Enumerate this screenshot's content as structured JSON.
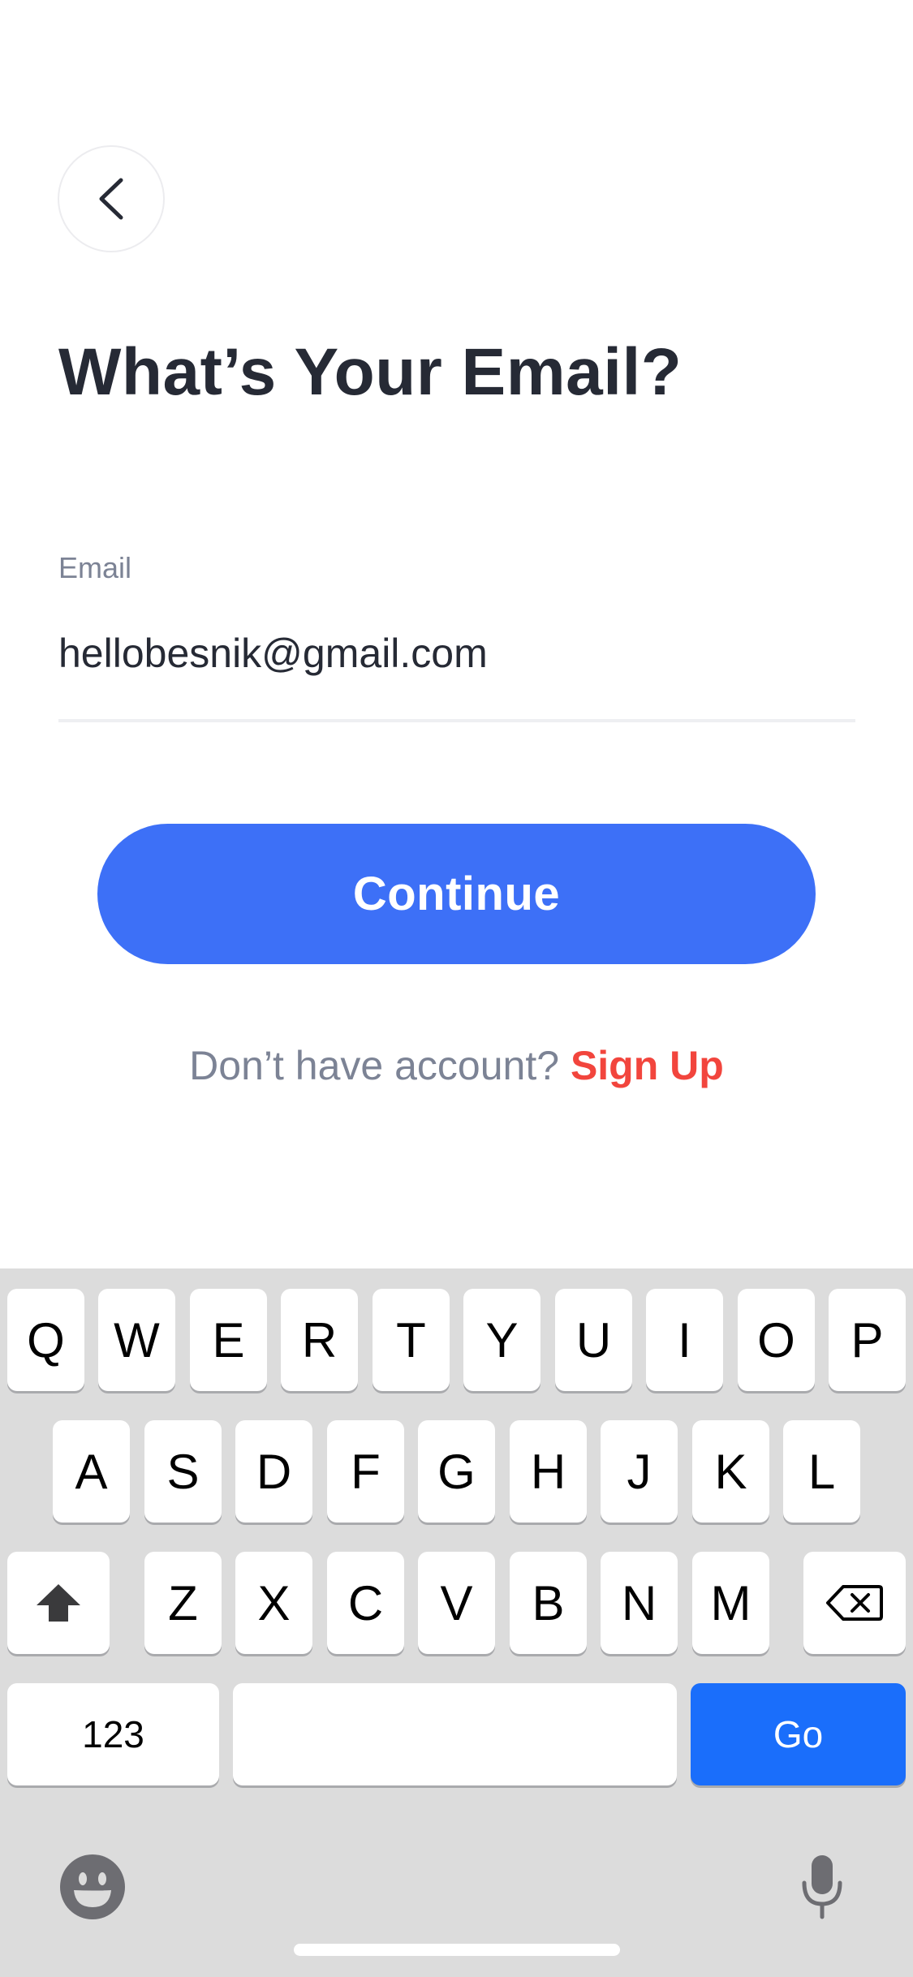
{
  "header": {
    "back_icon": "chevron-left-icon"
  },
  "title": "What’s Your Email?",
  "email_field": {
    "label": "Email",
    "value": "hellobesnik@gmail.com"
  },
  "continue_label": "Continue",
  "signup": {
    "prompt": "Don’t have account?",
    "link": "Sign Up"
  },
  "keyboard": {
    "row1": [
      "Q",
      "W",
      "E",
      "R",
      "T",
      "Y",
      "U",
      "I",
      "O",
      "P"
    ],
    "row2": [
      "A",
      "S",
      "D",
      "F",
      "G",
      "H",
      "J",
      "K",
      "L"
    ],
    "row3": [
      "Z",
      "X",
      "C",
      "V",
      "B",
      "N",
      "M"
    ],
    "numbers_label": "123",
    "go_label": "Go",
    "shift_icon": "shift-icon",
    "backspace_icon": "backspace-icon",
    "emoji_icon": "emoji-icon",
    "mic_icon": "microphone-icon"
  },
  "colors": {
    "primary": "#3d70f7",
    "signup_link": "#f2453d",
    "title": "#262a35",
    "muted": "#7c8395",
    "keyboard_bg": "#dcdcdc",
    "go_key": "#1a6efb"
  }
}
